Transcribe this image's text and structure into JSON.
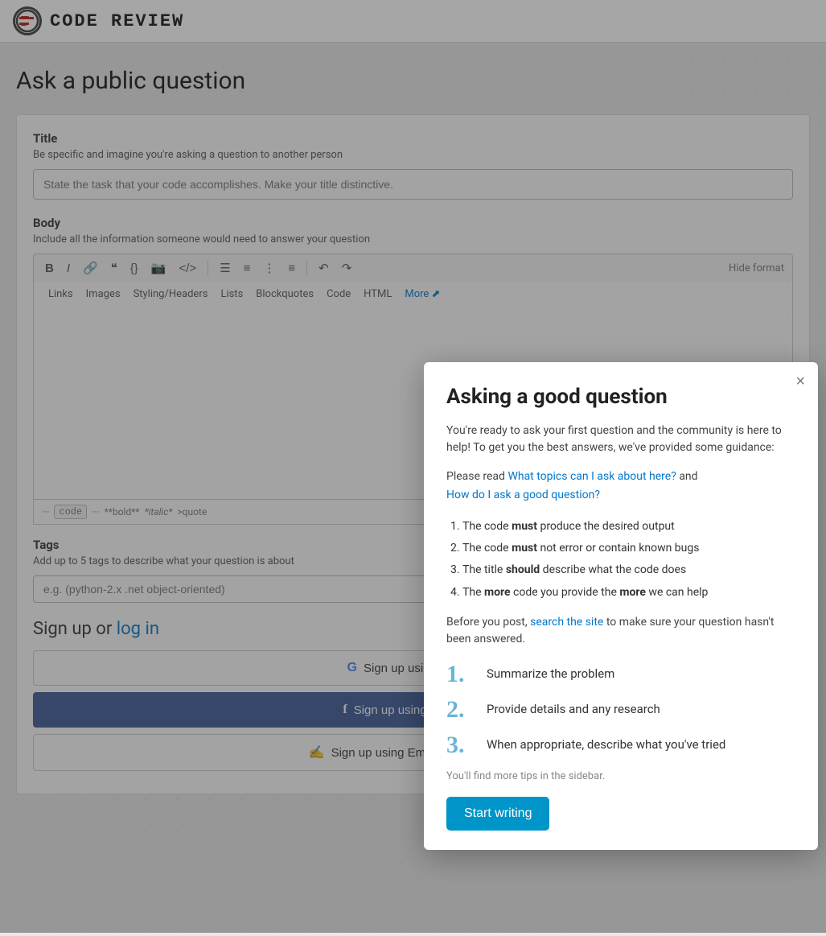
{
  "site": {
    "logo_text": "CR",
    "title": "CODE REVIEW"
  },
  "header": {
    "page_title": "Ask a public question"
  },
  "form": {
    "title_label": "Title",
    "title_description": "Be specific and imagine you're asking a question to another person",
    "title_placeholder": "State the task that your code accomplishes. Make your title distinctive.",
    "body_label": "Body",
    "body_description": "Include all the information someone would need to answer your question",
    "toolbar": {
      "hide_formatting": "Hide format",
      "tabs": [
        "Links",
        "Images",
        "Styling/Headers",
        "Lists",
        "Blockquotes",
        "Code",
        "HTML"
      ],
      "more": "More"
    },
    "format_hints": {
      "backtick": "···",
      "code": "code",
      "backtick2": "···",
      "bold": "**bold**",
      "italic": "*italic*",
      "quote": ">quote"
    },
    "tags_label": "Tags",
    "tags_description": "Add up to 5 tags to describe what your question is about",
    "tags_placeholder": "e.g. (python-2.x .net object-oriented)"
  },
  "signup": {
    "title": "Sign up or",
    "login_text": "log in",
    "google_btn": "Sign up using Google",
    "facebook_btn": "Sign up using Facebook",
    "email_btn": "Sign up using Email and Password"
  },
  "modal": {
    "title": "Asking a good question",
    "intro": "You're ready to ask your first question and the community is here to help! To get you the best answers, we've provided some guidance:",
    "links_prefix": "Please read",
    "link1_text": "What topics can I ask about here?",
    "links_and": "and",
    "link2_text": "How do I ask a good question?",
    "rules": [
      "The code must produce the desired output",
      "The code must not error or contain known bugs",
      "The title should describe what the code does",
      "The more code you provide the more we can help"
    ],
    "rules_bold": [
      "must",
      "must",
      "should",
      "more",
      "more"
    ],
    "search_note_prefix": "Before you post,",
    "search_link": "search the site",
    "search_note_suffix": "to make sure your question hasn't been answered.",
    "steps": [
      {
        "num": "1.",
        "text": "Summarize the problem"
      },
      {
        "num": "2.",
        "text": "Provide details and any research"
      },
      {
        "num": "3.",
        "text": "When appropriate, describe what you've tried"
      }
    ],
    "tip": "You'll find more tips in the sidebar.",
    "start_btn": "Start writing",
    "close_label": "×"
  }
}
